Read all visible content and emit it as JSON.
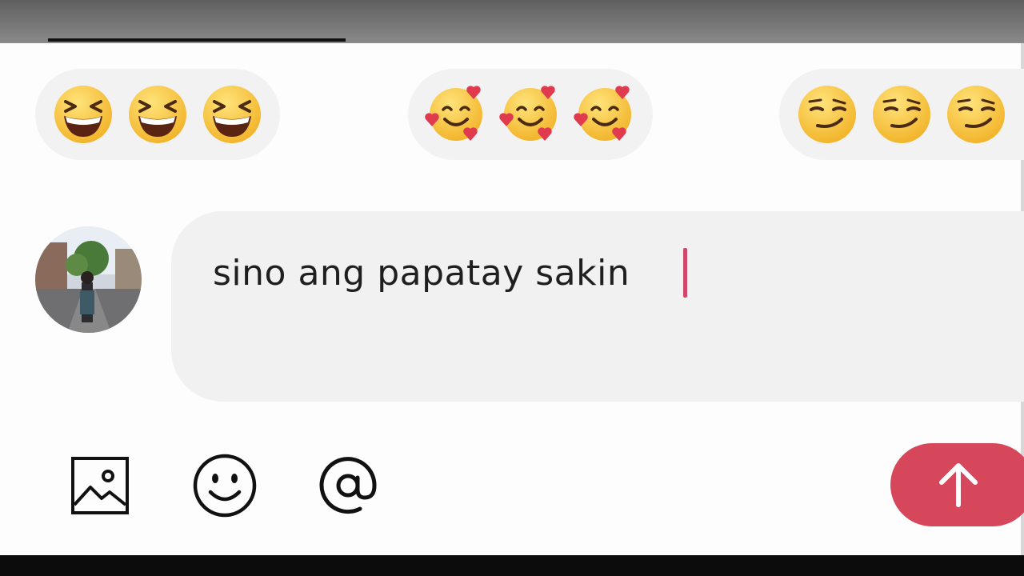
{
  "composer": {
    "text": "sino ang papatay sakin"
  },
  "quick_reactions": [
    {
      "emoji_name": "grinning-squinting-face",
      "repeat": 3
    },
    {
      "emoji_name": "smiling-face-with-hearts",
      "repeat": 3
    },
    {
      "emoji_name": "smirking-face",
      "repeat": 3
    }
  ],
  "toolbar": {
    "icons": [
      "image-icon",
      "emoji-icon",
      "mention-icon",
      "send-arrow-icon"
    ]
  },
  "colors": {
    "accent": "#d6475b",
    "caret": "#d2466b",
    "bubble": "#f1f1f1",
    "emoji_face": "#f6c23a"
  }
}
